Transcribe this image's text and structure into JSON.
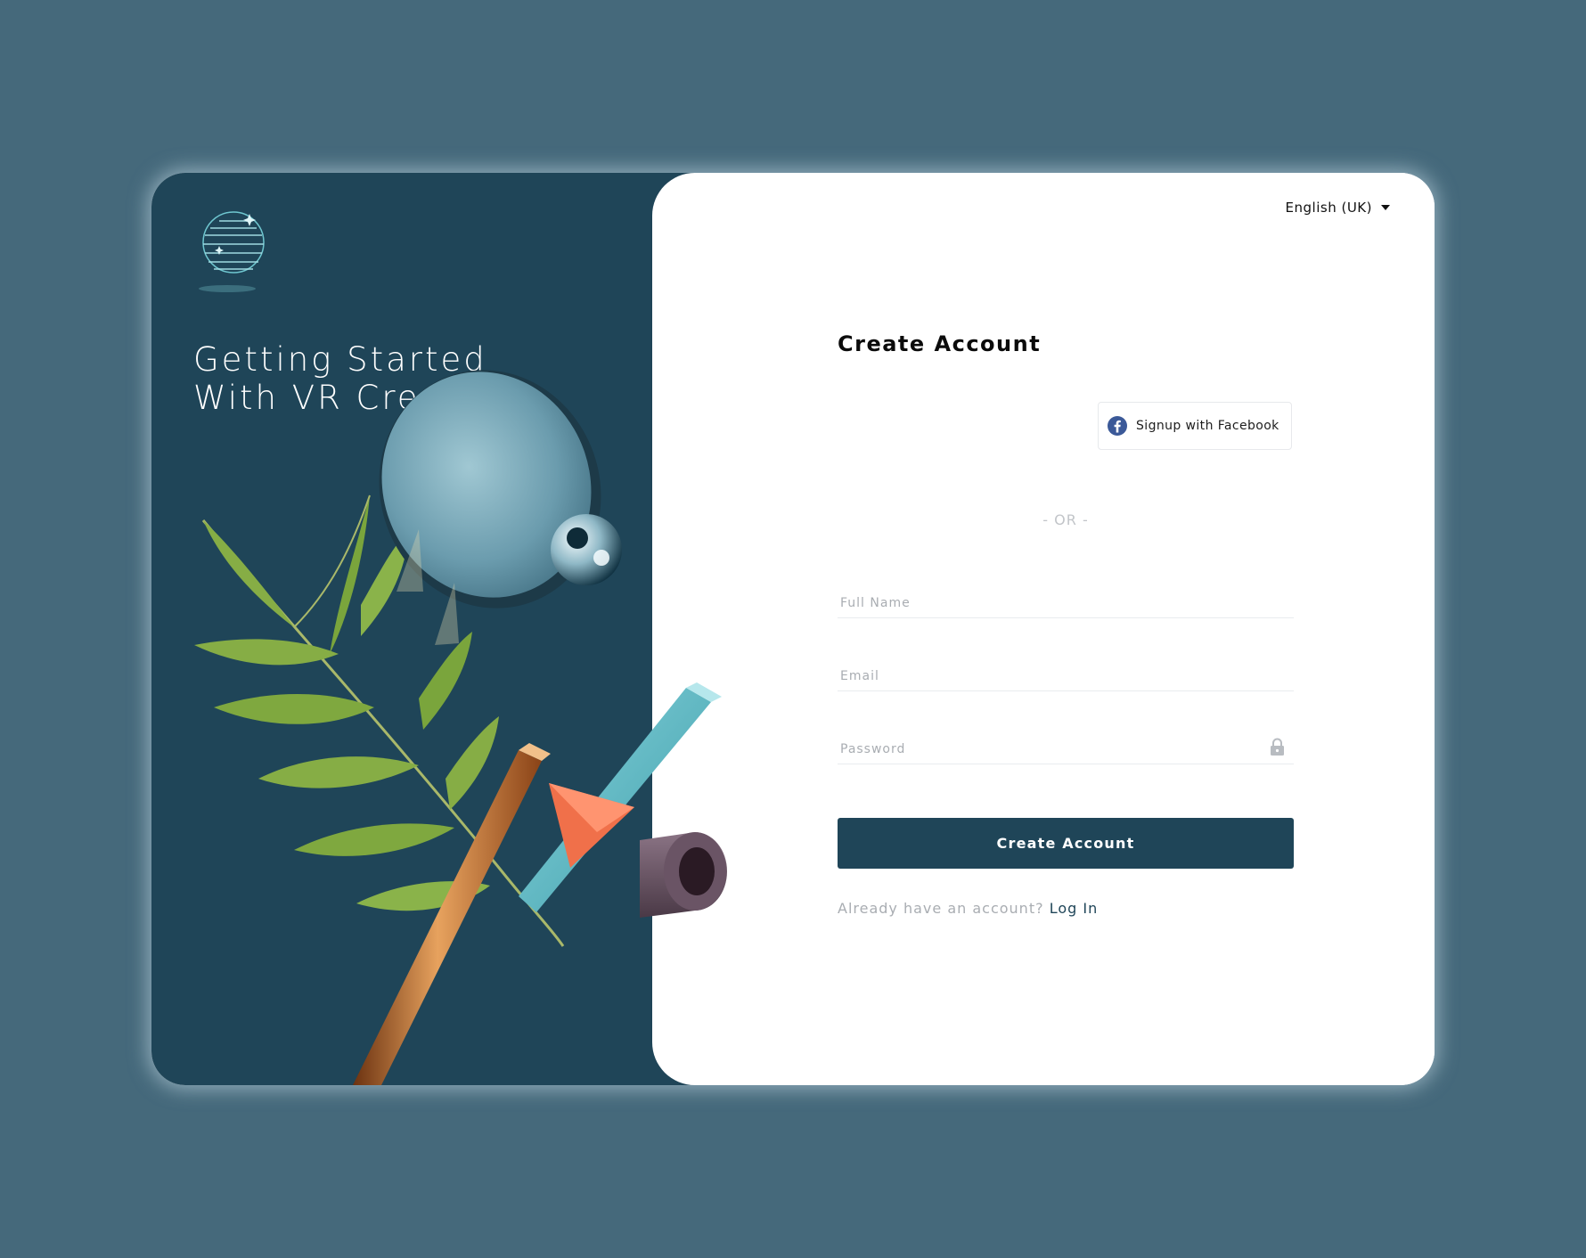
{
  "left": {
    "hero_title": "Getting Started With VR Creation"
  },
  "language": {
    "selected": "English (UK)"
  },
  "form": {
    "title": "Create Account",
    "facebook_label": "Signup with Facebook",
    "separator": "- OR -",
    "fields": {
      "full_name_placeholder": "Full Name",
      "email_placeholder": "Email",
      "password_placeholder": "Password"
    },
    "submit_label": "Create Account",
    "login_prompt": "Already have an account?",
    "login_link": "Log In"
  },
  "colors": {
    "page_bg": "#45697b",
    "panel_dark": "#1f4558",
    "button": "#1f4558",
    "accent_teal": "#5fb3bd",
    "facebook_blue": "#3b5998"
  },
  "icons": {
    "logo": "globe-logo-icon",
    "dropdown": "chevron-down-icon",
    "facebook": "facebook-icon",
    "password": "lock-icon"
  }
}
